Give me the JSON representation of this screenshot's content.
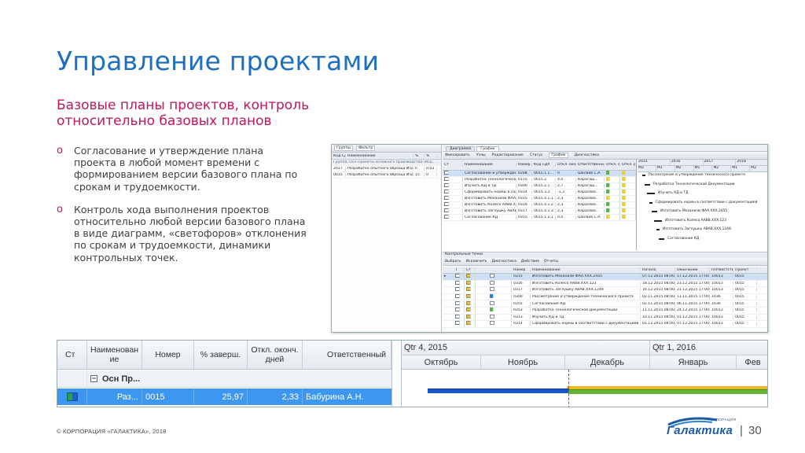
{
  "slide": {
    "title": "Управление проектами",
    "subtitle": "Базовые планы проектов, контроль относительно базовых планов",
    "bullets": [
      "Согласование и утверждение плана проекта в любой момент времени с формированием версии базового плана по срокам и трудоемкости.",
      "Контроль хода выполнения проектов относительно любой версии базового плана в виде диаграмм, «светофоров» отклонения по срокам и трудоемкости, динамики контрольных точек."
    ],
    "bullet_mark": "o"
  },
  "screenshot": {
    "left_toolbar": [
      "Группы",
      "Фильтр"
    ],
    "left_columns": [
      "Код СДР",
      "Наименование",
      "%",
      "%"
    ],
    "left_group_row": "Группа: Осн Проекты основного производства (Изд...",
    "left_rows": [
      [
        "2017",
        "Разработка опытного образца Изд...",
        "0",
        "0,03"
      ],
      [
        "0015",
        "Разработка опытного образца Изд...",
        "15",
        "0"
      ]
    ],
    "tabs": [
      "Диаграмма",
      "График"
    ],
    "main_toolbar": [
      "Фиксировать",
      "Узлы",
      "Редактирование",
      "Статус",
      "График",
      "Диагностика"
    ],
    "upper_columns": [
      "Ст",
      "Наименование",
      "Номер",
      "Код СДР",
      "Откл. оконч. дней",
      "Ответственный",
      "Откл. оконч. дней",
      "Откл. разм."
    ],
    "upper_rows": [
      [
        "Согласование и утверждение...",
        "0208",
        "0015.1.1...",
        "0",
        "Шалаев С.А."
      ],
      [
        "Разработка Технологическо...",
        "0155",
        "0015.2",
        "4,0",
        "Карагаш..."
      ],
      [
        "Изучить КД и ТД",
        "0300",
        "0015.2.1",
        "2,7",
        "Карагаш..."
      ],
      [
        "Сформировать нормы в соот...",
        "0314",
        "0015.3.2",
        "-1,3",
        "Карасева..."
      ],
      [
        "Изготовить Механизм ФАА...",
        "0315",
        "0015.4.1.1",
        "2,3",
        "Карасева..."
      ],
      [
        "Изготовить Колесо ААВВ.ХХ...",
        "0316",
        "0015.4.1.2",
        "2,3",
        "Карасева..."
      ],
      [
        "Изготовить Заглушку АВАВ...",
        "0317",
        "0015.4.1.3",
        "2,3",
        "Карасева..."
      ],
      [
        "Согласование КД",
        "0355",
        "0015.1.2.1",
        "0,0",
        "Шалаев С.А."
      ]
    ],
    "upper_gantt_years": [
      "2015",
      "2016",
      "2017",
      "2018"
    ],
    "upper_gantt_quarters": [
      "М2",
      "М1",
      "М2",
      "М1",
      "М2",
      "М1",
      "М2"
    ],
    "upper_gantt_labels": [
      "Рассмотрение и утверждение технического проекта",
      "Разработка Технологической Документации",
      "Изучить КД и ТД",
      "Сформировать нормы в соответствии с документацией",
      "Изготовить Механизм ФАА.ХХХ.2455",
      "Изготовить Колесо ААВВ.ХХХ.123",
      "Изготовить Заглушку АВАВ.ХХХ.1248",
      "Согласование КД"
    ],
    "lower_title": "Контрольные точки",
    "lower_toolbar": [
      "Выбрать",
      "Исключить",
      "Диагностика",
      "Действия",
      "Отчеты"
    ],
    "lower_columns": [
      "Т",
      "Ст",
      "Номер",
      "Наименование",
      "Начало",
      "Окончание",
      "ПОтвестств...",
      "Проект"
    ],
    "lower_rows": [
      [
        "0315",
        "Изготовить Механизм ФАА.ХХХ.2455",
        "07.12.2015 08:00",
        "17.12.2015 17:00",
        "10013",
        "0015"
      ],
      [
        "0316",
        "Изготовить Колесо ААВВ.ХХХ.123",
        "18.12.2015 08:00",
        "23.12.2015 17:00",
        "10013",
        "0015"
      ],
      [
        "0317",
        "Изготовить Заглушку АВАВ.ХХХ.1248",
        "16.12.2015 08:00",
        "21.12.2015 17:00",
        "10013",
        "0015"
      ],
      [
        "0300",
        "Рассмотрение и утверждение технического проекта",
        "02.11.2015 08:00",
        "11.11.2015 17:00",
        "1036",
        "0015"
      ],
      [
        "0355",
        "Согласование КД",
        "02.11.2015 08:00",
        "06.11.2015 17:00",
        "1036",
        "0015"
      ],
      [
        "0353",
        "Разработка Технологической Документации",
        "11.11.2015 08:00",
        "24.12.2015 17:00",
        "10013",
        "0015"
      ],
      [
        "0313",
        "Изучить КД и ТД",
        "10.11.2015 08:00",
        "01.12.2015 17:00",
        "10013",
        "0015"
      ],
      [
        "0314",
        "Сформировать нормы в соответствии с документацией",
        "01.12.2015 08:00",
        "07.12.2015 17:00",
        "10013",
        "0015"
      ]
    ]
  },
  "zoom": {
    "columns": [
      "Ст",
      "Наименован ие",
      "Номер",
      "% заверш.",
      "Откл. оконч. дней",
      "Ответственный"
    ],
    "group_row": {
      "expander": "−",
      "name": "Осн Пр..."
    },
    "active_row": {
      "name": "Раз...",
      "number": "0015",
      "percent": "25,97",
      "deviation": "2,33",
      "responsible": "Бабурина А.Н."
    },
    "quarters": [
      "Qtr 4, 2015",
      "Qtr 1, 2016"
    ],
    "months": [
      "Октябрь",
      "Ноябрь",
      "Декабрь",
      "Январь",
      "Фев"
    ]
  },
  "footer": {
    "copyright": "© КОРПОРАЦИЯ «ГАЛАКТИКА», 2018",
    "logo_small": "КОРПОРАЦИЯ",
    "logo_word": "Галактика",
    "separator": "|",
    "page_number": "30"
  },
  "colors": {
    "title": "#1e6fc0",
    "accent": "#c0155d",
    "selected_row": "#3b97f0",
    "bar_blue": "#1a54c8",
    "bar_green": "#62b631",
    "bar_orange": "#f5b51e",
    "today_line": "#e0202a"
  }
}
